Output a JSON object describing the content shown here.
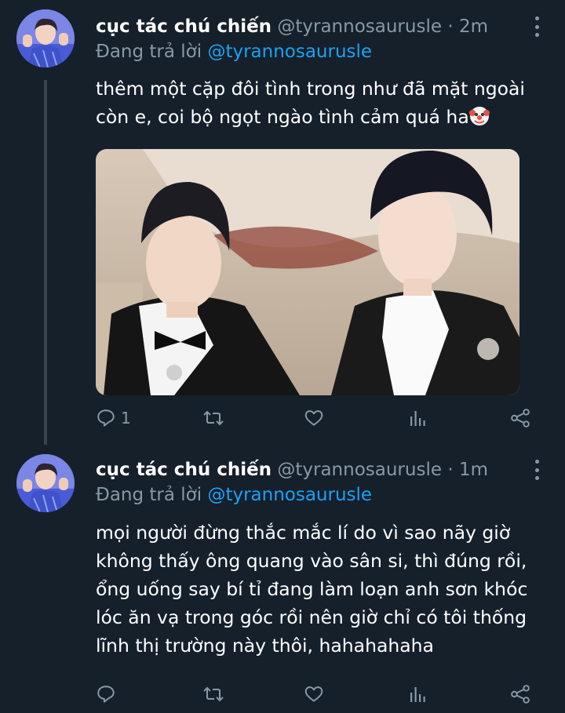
{
  "tweets": [
    {
      "display_name": "cục tác chú chiến",
      "handle": "@tyrannosaurusle",
      "separator": "·",
      "time": "2m",
      "reply_prefix": "Đang trả lời",
      "reply_to": "@tyrannosaurusle",
      "text": "thêm một cặp đôi tình trong như đã mặt ngoài\ncòn e, coi bộ ngọt ngào tình cảm quá ha",
      "emoji": "clown-face",
      "reply_count": "1",
      "has_media": true
    },
    {
      "display_name": "cục tác chú chiến",
      "handle": "@tyrannosaurusle",
      "separator": "·",
      "time": "1m",
      "reply_prefix": "Đang trả lời",
      "reply_to": "@tyrannosaurusle",
      "text": "mọi người đừng thắc mắc lí do vì sao nãy giờ\nkhông thấy ông quang vào sân si, thì đúng rồi,\nổng uống say bí tỉ đang làm loạn anh sơn khóc\nlóc ăn vạ trong góc rồi nên giờ chỉ có tôi thống\nlĩnh thị trường này thôi, hahahahaha",
      "reply_count": "",
      "has_media": false
    }
  ],
  "icons": [
    "reply-icon",
    "retweet-icon",
    "like-icon",
    "analytics-icon",
    "share-icon",
    "more-icon"
  ],
  "colors": {
    "background": "#15202b",
    "secondary_text": "#8899a6",
    "link": "#1da1f2",
    "thread_line": "#38444d"
  }
}
